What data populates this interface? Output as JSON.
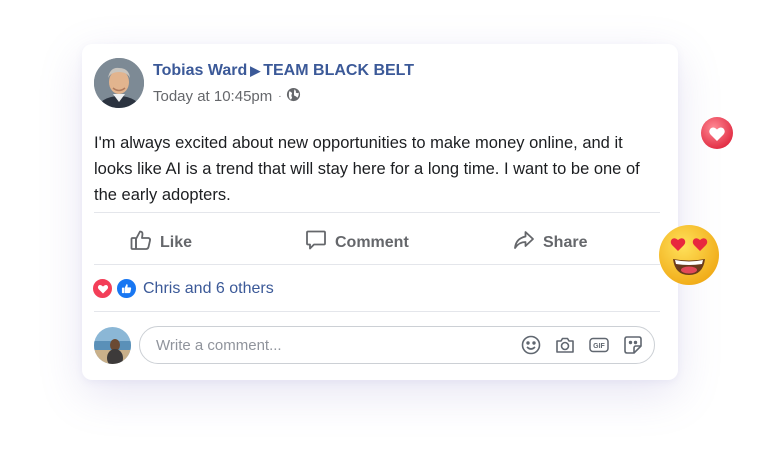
{
  "post": {
    "author": "Tobias Ward",
    "group": "TEAM BLACK BELT",
    "arrow": "▶",
    "timestamp": "Today at 10:45pm",
    "dot": "·",
    "text": "I'm always excited about new opportunities to make money online, and it looks like AI is a trend that will stay here for a long time. I want to be one of the early adopters."
  },
  "actions": {
    "like": "Like",
    "comment": "Comment",
    "share": "Share"
  },
  "reactions": {
    "summary": "Chris and 6 others",
    "icons": [
      "love-icon",
      "like-icon"
    ]
  },
  "comment_box": {
    "placeholder": "Write a comment...",
    "icons": [
      "emoji-icon",
      "camera-icon",
      "gif-icon",
      "sticker-icon"
    ]
  },
  "colors": {
    "author": "#3b5998",
    "meta": "#65676b",
    "love": "#f33e58",
    "like": "#1877f2"
  }
}
